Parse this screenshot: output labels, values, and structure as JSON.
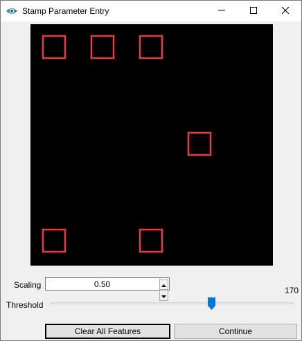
{
  "window": {
    "title": "Stamp Parameter Entry",
    "icon": "eye-icon",
    "controls": [
      "minimize-icon",
      "maximize-icon",
      "close-icon"
    ]
  },
  "canvas": {
    "background": "#000000",
    "feature_color": "#e0403e",
    "feature_count": 6
  },
  "scaling": {
    "label": "Scaling",
    "value": "0.50"
  },
  "threshold": {
    "label": "Threshold",
    "value": "170",
    "fraction": 0.67
  },
  "buttons": {
    "clear_label": "Clear All Features",
    "continue_label": "Continue"
  }
}
